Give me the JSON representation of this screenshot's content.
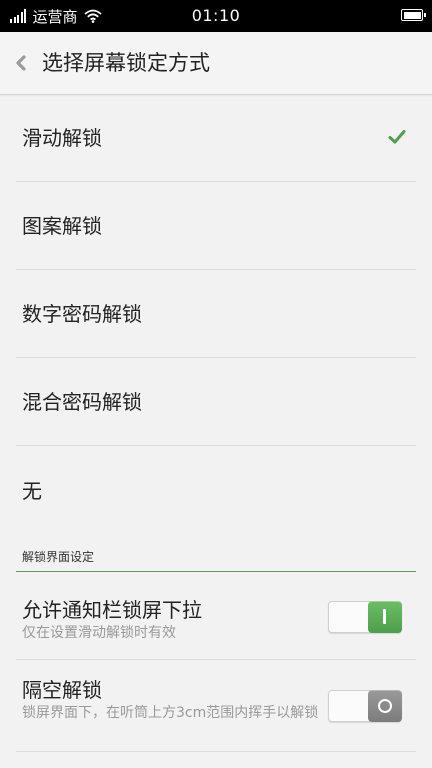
{
  "status_bar": {
    "carrier": "运营商",
    "time": "01:10"
  },
  "header": {
    "title": "选择屏幕锁定方式",
    "back_icon": "chevron-left-icon"
  },
  "options": [
    {
      "label": "滑动解锁",
      "selected": true
    },
    {
      "label": "图案解锁",
      "selected": false
    },
    {
      "label": "数字密码解锁",
      "selected": false
    },
    {
      "label": "混合密码解锁",
      "selected": false
    },
    {
      "label": "无",
      "selected": false
    }
  ],
  "section": {
    "title": "解锁界面设定"
  },
  "settings": [
    {
      "title": "允许通知栏锁屏下拉",
      "description": "仅在设置滑动解锁时有效",
      "enabled": true
    },
    {
      "title": "隔空解锁",
      "description": "锁屏界面下，在听筒上方3cm范围内挥手以解锁",
      "enabled": false
    }
  ],
  "colors": {
    "accent_green": "#5aaa52",
    "check_green": "#4e9e4e",
    "toggle_off_gray": "#888888",
    "status_bar_bg": "#000000"
  }
}
